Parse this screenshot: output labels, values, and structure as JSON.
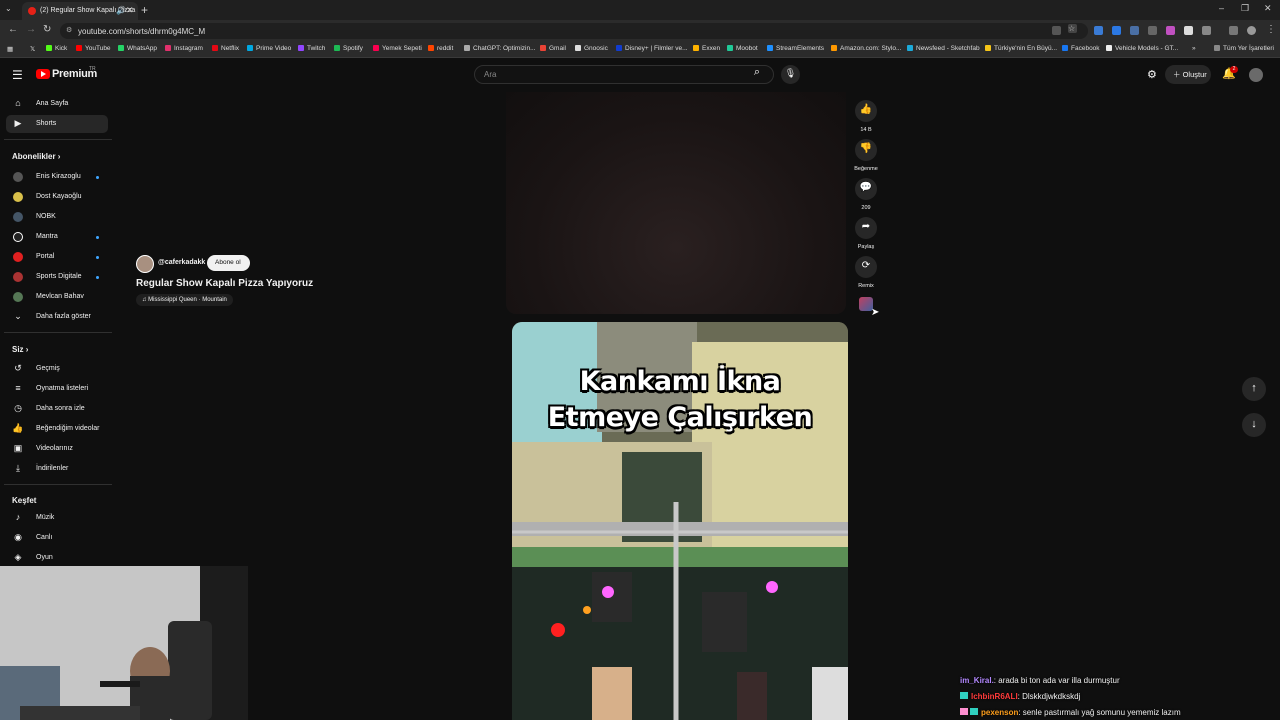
{
  "browser": {
    "tab_title": "(2) Regular Show Kapalı Pizza",
    "url": "youtube.com/shorts/dhrm0g4MC_M",
    "bookmarks": [
      "Kick",
      "YouTube",
      "WhatsApp",
      "Instagram",
      "Netflix",
      "Prime Video",
      "Twitch",
      "Spotify",
      "Yemek Sepeti",
      "reddit",
      "ChatGPT: Optimizin...",
      "Gmail",
      "Gnoosic",
      "Disney+ | Filmler ve...",
      "Exxen",
      "Moobot",
      "StreamElements",
      "Amazon.com: Stylo...",
      "Newsfeed - Sketchfab",
      "Türkiye'nin En Büyü...",
      "Facebook",
      "Vehicle Models - GT..."
    ],
    "all_bookmarks": "Tüm Yer İşaretleri"
  },
  "header": {
    "brand": "Premium",
    "country": "TR",
    "search_placeholder": "Ara",
    "create_label": "Oluştur",
    "notif_count": "2"
  },
  "sidebar": {
    "main": [
      {
        "label": "Ana Sayfa",
        "icon": "home-icon"
      },
      {
        "label": "Shorts",
        "icon": "shorts-icon",
        "active": true
      }
    ],
    "subs_title": "Abonelikler",
    "subs": [
      {
        "label": "Enis Kirazoglu",
        "color": "#555555",
        "dot": true
      },
      {
        "label": "Dost Kayaoğlu",
        "color": "#d9c04a",
        "dot": false
      },
      {
        "label": "NOBK",
        "color": "#445566",
        "dot": false
      },
      {
        "label": "Mantra",
        "color": "#222222",
        "dot": true
      },
      {
        "label": "Portal",
        "color": "#e02020",
        "dot": true
      },
      {
        "label": "Sports Digitale",
        "color": "#aa3333",
        "dot": true
      },
      {
        "label": "Mevlcan Bahav",
        "color": "#557755",
        "dot": false
      }
    ],
    "show_more": "Daha fazla göster",
    "you_title": "Siz",
    "you": [
      {
        "label": "Geçmiş",
        "icon": "history-icon"
      },
      {
        "label": "Oynatma listeleri",
        "icon": "playlists-icon"
      },
      {
        "label": "Daha sonra izle",
        "icon": "watch-later-icon"
      },
      {
        "label": "Beğendiğim videolar",
        "icon": "liked-icon"
      },
      {
        "label": "Videolarınız",
        "icon": "your-videos-icon"
      },
      {
        "label": "İndirilenler",
        "icon": "downloads-icon"
      }
    ],
    "explore_title": "Keşfet",
    "explore": [
      {
        "label": "Müzik",
        "icon": "music-icon"
      },
      {
        "label": "Canlı",
        "icon": "live-icon"
      },
      {
        "label": "Oyun",
        "icon": "gaming-icon"
      }
    ]
  },
  "short": {
    "channel": "@caferkadakk",
    "subscribe_label": "Abone ol",
    "title": "Regular Show Kapalı Pizza Yapıyoruz",
    "music": "Mississippi Queen · Mountain",
    "likes": "14 B",
    "dislike_label": "Beğenme",
    "comments": "209",
    "share_label": "Paylaş",
    "remix_label": "Remix"
  },
  "next_short": {
    "overlay_line1": "Kankamı İkna",
    "overlay_line2": "Etmeye Çalışırken"
  },
  "chat": [
    {
      "user": "im_Kiral.",
      "message": ": arada bi ton ada var illa durmuştur",
      "color": "#b388ff"
    },
    {
      "user": "IchbinR6ALI",
      "message": ": Dlskkdjwkdkskdj",
      "color": "#ff3b3b"
    },
    {
      "user": "pexenson",
      "message": ": senle pastırmalı yağ somunu yememiz lazım",
      "color": "#ff9f1c"
    }
  ]
}
